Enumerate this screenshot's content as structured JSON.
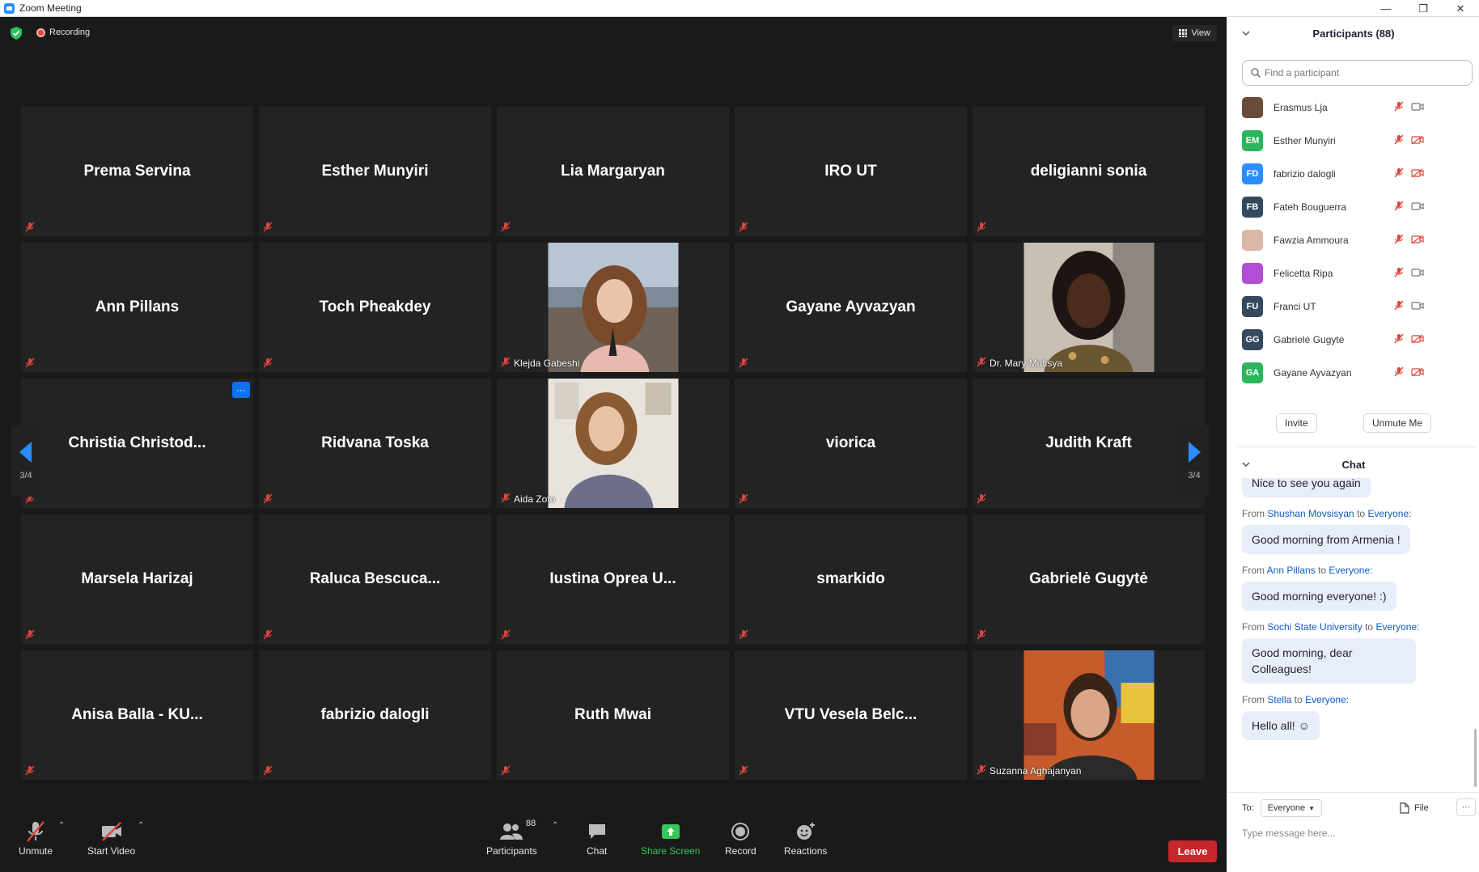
{
  "window": {
    "title": "Zoom Meeting",
    "minimize": "—",
    "restore": "❐",
    "close": "✕"
  },
  "topbar": {
    "recording": "Recording",
    "view": "View"
  },
  "tiles": [
    {
      "name": "Prema Servina"
    },
    {
      "name": "Esther Munyiri"
    },
    {
      "name": "Lia Margaryan"
    },
    {
      "name": "IRO UT"
    },
    {
      "name": "deligianni sonia"
    },
    {
      "name": "Ann Pillans"
    },
    {
      "name": "Toch Pheakdey"
    },
    {
      "label": "Klejda Gabeshi",
      "photo": "woman-beach"
    },
    {
      "name": "Gayane Ayvazyan"
    },
    {
      "label": "Dr. Mary Mutisya",
      "photo": "woman-portrait"
    },
    {
      "name": "Christia  Christod...",
      "more": "···"
    },
    {
      "name": "Ridvana Toska"
    },
    {
      "label": "Aida Zoto",
      "photo": "woman-indoor"
    },
    {
      "name": "viorica"
    },
    {
      "name": "Judith Kraft"
    },
    {
      "name": "Marsela Harizaj"
    },
    {
      "name": "Raluca  Bescuca..."
    },
    {
      "name": "Iustina Oprea  U..."
    },
    {
      "name": "smarkido"
    },
    {
      "name": "Gabrielė Gugytė"
    },
    {
      "name": "Anisa Balla - KU..."
    },
    {
      "name": "fabrizio dalogli"
    },
    {
      "name": "Ruth Mwai"
    },
    {
      "name": "VTU Vesela Belc..."
    },
    {
      "label": "Suzanna Aghajanyan",
      "photo": "woman-art"
    }
  ],
  "pagination": {
    "left": "3/4",
    "right": "3/4"
  },
  "toolbar": {
    "unmute": "Unmute",
    "start_video": "Start Video",
    "participants": "Participants",
    "participants_count": "88",
    "chat": "Chat",
    "share_screen": "Share Screen",
    "record": "Record",
    "reactions": "Reactions",
    "leave": "Leave"
  },
  "participants_panel": {
    "title": "Participants (88)",
    "search_placeholder": "Find a participant",
    "items": [
      {
        "name": "Erasmus Lja",
        "initials": "",
        "color": "#6b4b3a",
        "mic": "muted",
        "video": "on"
      },
      {
        "name": "Esther Munyiri",
        "initials": "EM",
        "color": "#2db55d",
        "mic": "muted",
        "video": "off"
      },
      {
        "name": "fabrizio dalogli",
        "initials": "FD",
        "color": "#2d8cff",
        "mic": "muted",
        "video": "off"
      },
      {
        "name": "Fateh Bouguerra",
        "initials": "FB",
        "color": "#34495e",
        "mic": "muted",
        "video": "on"
      },
      {
        "name": "Fawzia Ammoura",
        "initials": "",
        "color": "#d9b8a8",
        "mic": "muted",
        "video": "off"
      },
      {
        "name": "Felicetta Ripa",
        "initials": "",
        "color": "#b04ed6",
        "mic": "muted",
        "video": "on"
      },
      {
        "name": "Franci UT",
        "initials": "FU",
        "color": "#34495e",
        "mic": "muted",
        "video": "on"
      },
      {
        "name": "Gabrielė Gugytė",
        "initials": "GG",
        "color": "#34495e",
        "mic": "muted",
        "video": "off"
      },
      {
        "name": "Gayane Ayvazyan",
        "initials": "GA",
        "color": "#2db55d",
        "mic": "muted",
        "video": "off"
      },
      {
        "name": "",
        "initials": "",
        "color": "#e2c3a8",
        "mic": "muted",
        "video": "on"
      }
    ],
    "invite": "Invite",
    "unmute_me": "Unmute Me"
  },
  "chat": {
    "title": "Chat",
    "messages": [
      {
        "from": "",
        "to": "",
        "text": "Nice to see you again"
      },
      {
        "from": "Shushan Movsisyan",
        "to": "Everyone:",
        "text": "Good morning from Armenia !"
      },
      {
        "from": "Ann Pillans",
        "to": "Everyone:",
        "text": "Good morning everyone! :)"
      },
      {
        "from": "Sochi State University",
        "to": "Everyone:",
        "text": "Good morning, dear Colleagues!"
      },
      {
        "from": "Stella",
        "to": "Everyone:",
        "text": "Hello all! ☺"
      }
    ],
    "from_word": "From",
    "to_word": "to",
    "to_label": "To:",
    "to_value": "Everyone",
    "file": "File",
    "more": "···",
    "placeholder": "Type message here..."
  },
  "colors": {
    "accent": "#0e72ed",
    "leave": "#c8262d",
    "share": "#35c759",
    "mute_red": "#e0453b"
  }
}
